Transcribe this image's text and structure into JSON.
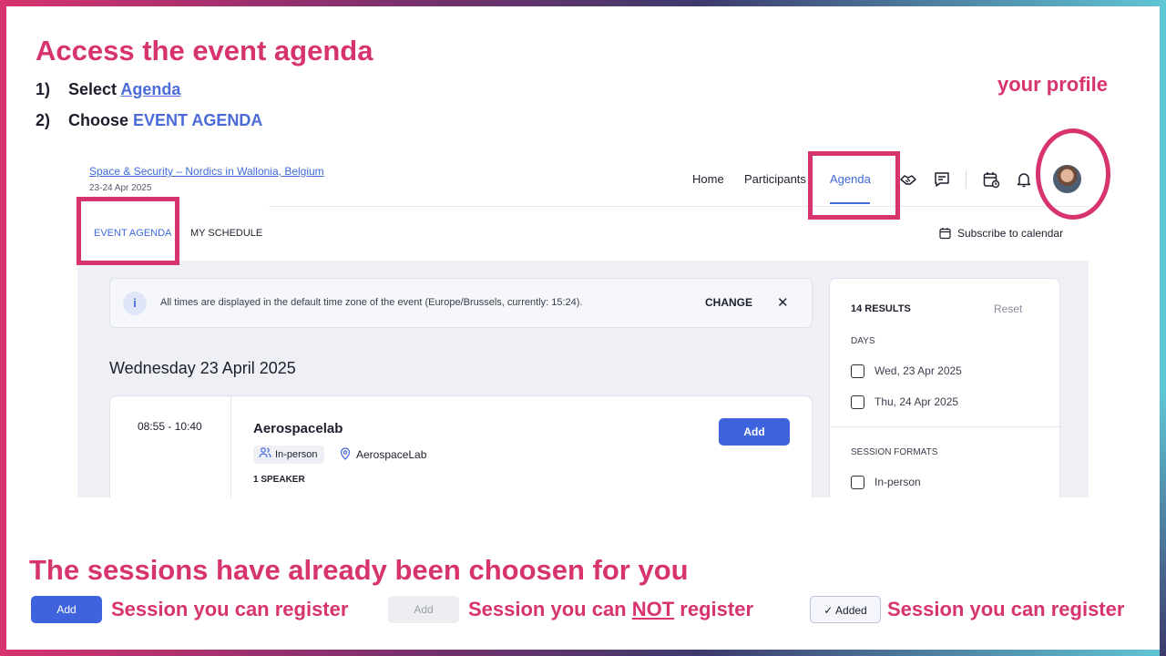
{
  "slide": {
    "title": "Access the event agenda",
    "steps": [
      {
        "num": "1)",
        "text": "Select ",
        "link": "Agenda"
      },
      {
        "num": "2)",
        "text": "Choose ",
        "accent": "EVENT AGENDA"
      }
    ],
    "profile_note": "your profile",
    "bottom_heading": "The sessions have already been choosen for you",
    "legend": [
      {
        "button": "Add",
        "text": "Session you can register"
      },
      {
        "button": "Add",
        "text_before": "Session you can ",
        "text_underline": "NOT",
        "text_after": " register"
      },
      {
        "button": "Added",
        "text": "Session you can register"
      }
    ],
    "colors": {
      "accent": "#d6336f",
      "brand_blue": "#3f63dc"
    }
  },
  "app": {
    "event_title": "Space & Security – Nordics in Wallonia, Belgium",
    "event_dates": "23-24 Apr 2025",
    "nav": [
      "Home",
      "Participants",
      "Agenda"
    ],
    "nav_icons": [
      "handshake-icon",
      "chat-icon",
      "calendar-clock-icon",
      "bell-icon",
      "avatar"
    ],
    "tabs": [
      "EVENT AGENDA",
      "MY SCHEDULE"
    ],
    "subscribe_label": "Subscribe to calendar",
    "timezone_notice": "All times are displayed in the default time zone of the event (Europe/Brussels, currently: 15:24).",
    "timezone_change": "CHANGE",
    "day_heading": "Wednesday 23 April 2025",
    "session": {
      "time": "08:55 - 10:40",
      "title": "Aerospacelab",
      "format": "In-person",
      "location": "AerospaceLab",
      "speakers": "1 SPEAKER",
      "button": "Add"
    },
    "filters": {
      "results": "14 RESULTS",
      "reset": "Reset",
      "days_label": "DAYS",
      "days": [
        "Wed, 23 Apr 2025",
        "Thu, 24 Apr 2025"
      ],
      "formats_label": "SESSION FORMATS",
      "formats": [
        "In-person"
      ]
    }
  }
}
